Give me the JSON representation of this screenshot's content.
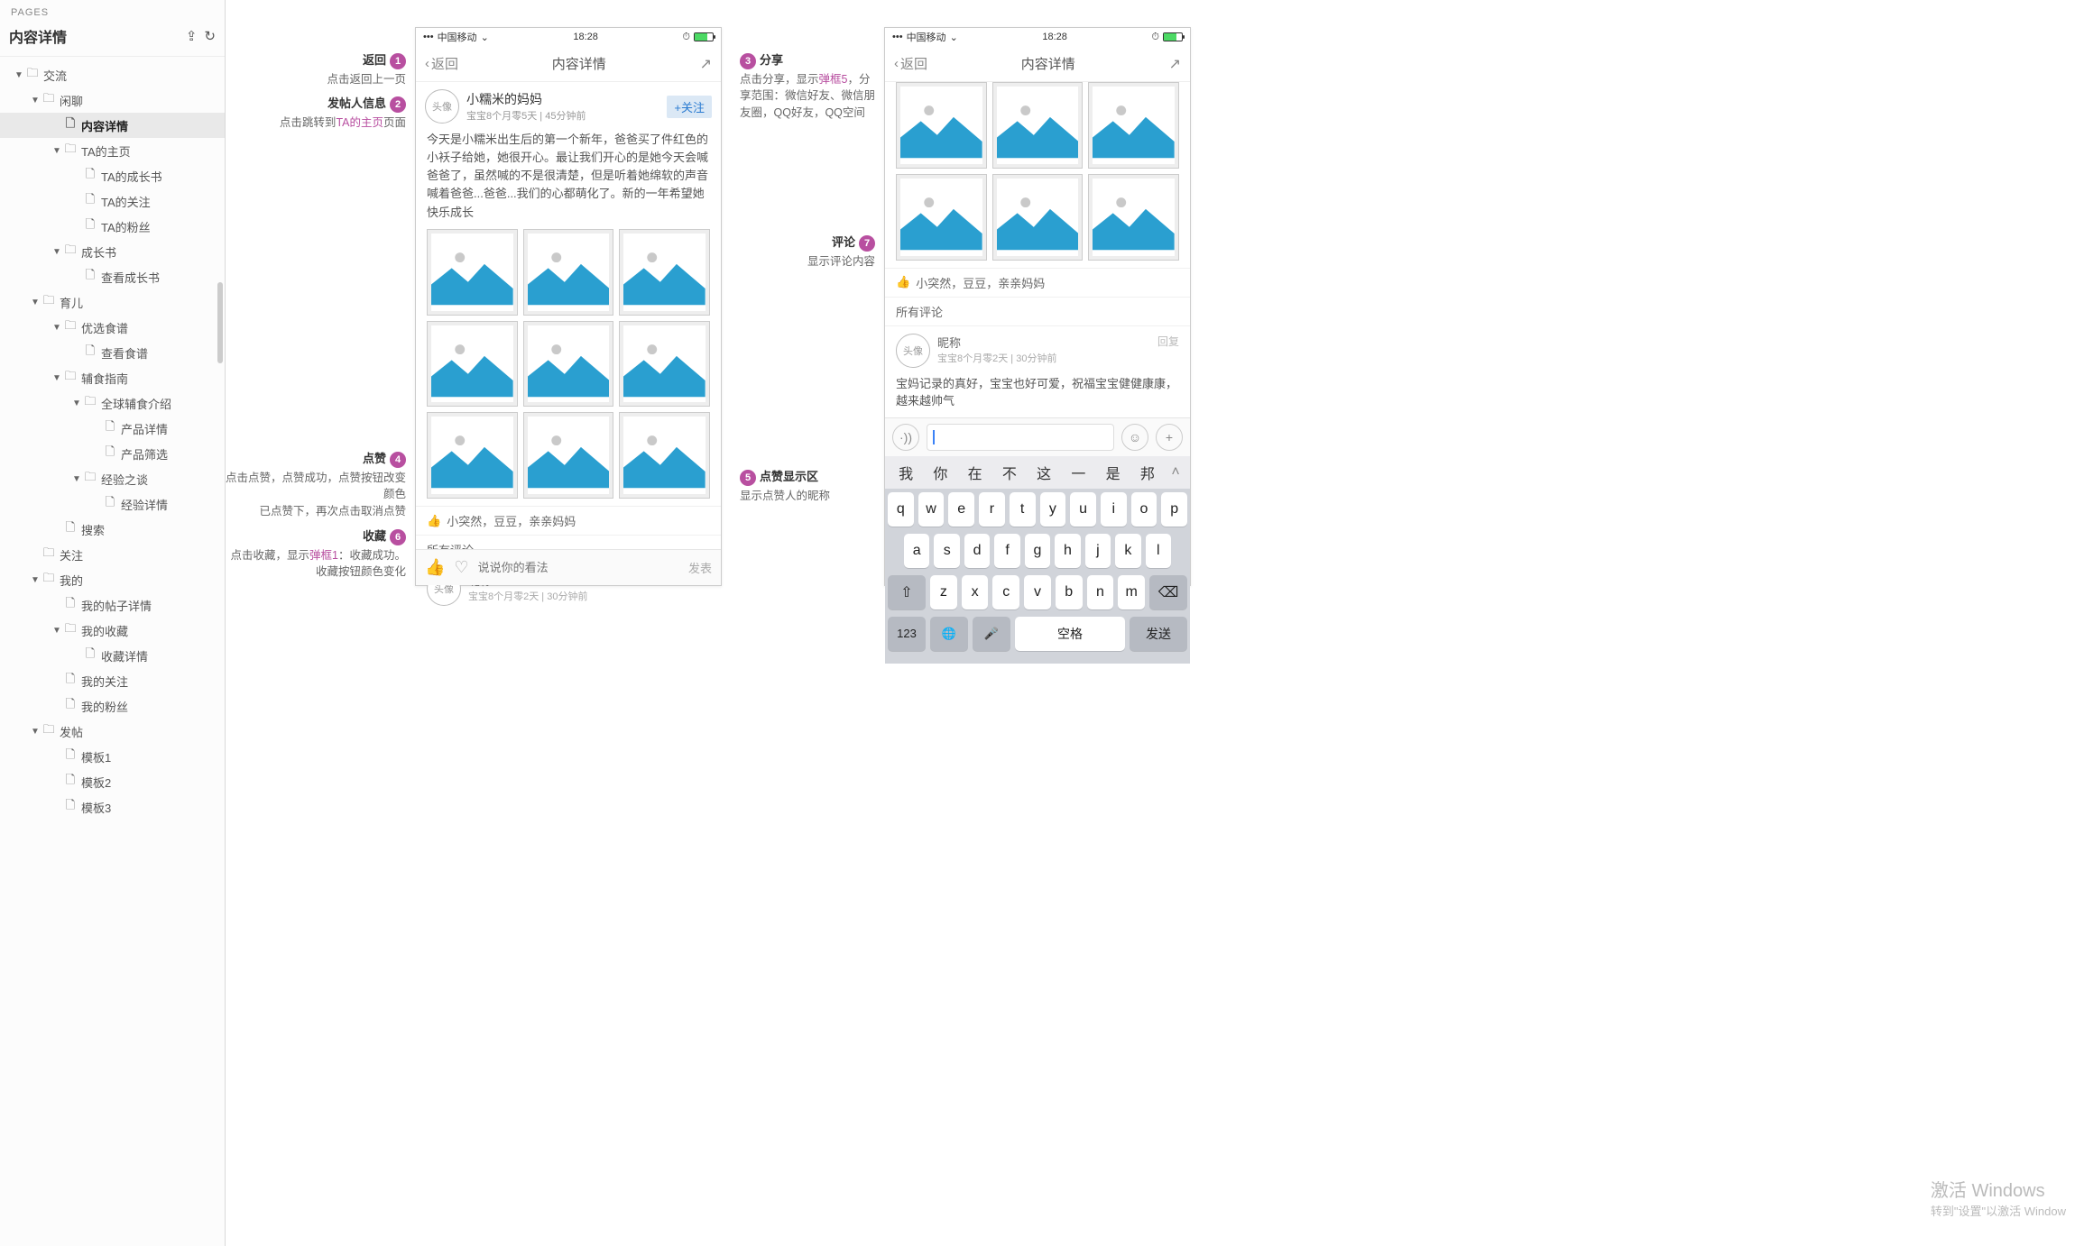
{
  "sidebar": {
    "header": "PAGES",
    "title": "内容详情",
    "tree": [
      {
        "indent": 0,
        "toggle": "▼",
        "icon": "folder",
        "label": "交流"
      },
      {
        "indent": 1,
        "toggle": "▼",
        "icon": "folder",
        "label": "闲聊"
      },
      {
        "indent": 2,
        "toggle": "",
        "icon": "page",
        "label": "内容详情",
        "selected": true
      },
      {
        "indent": 2,
        "toggle": "▼",
        "icon": "folder",
        "label": "TA的主页"
      },
      {
        "indent": 3,
        "toggle": "",
        "icon": "page",
        "label": "TA的成长书"
      },
      {
        "indent": 3,
        "toggle": "",
        "icon": "page",
        "label": "TA的关注"
      },
      {
        "indent": 3,
        "toggle": "",
        "icon": "page",
        "label": "TA的粉丝"
      },
      {
        "indent": 2,
        "toggle": "▼",
        "icon": "folder",
        "label": "成长书"
      },
      {
        "indent": 3,
        "toggle": "",
        "icon": "page",
        "label": "查看成长书"
      },
      {
        "indent": 1,
        "toggle": "▼",
        "icon": "folder",
        "label": "育儿"
      },
      {
        "indent": 2,
        "toggle": "▼",
        "icon": "folder",
        "label": "优选食谱"
      },
      {
        "indent": 3,
        "toggle": "",
        "icon": "page",
        "label": "查看食谱"
      },
      {
        "indent": 2,
        "toggle": "▼",
        "icon": "folder",
        "label": "辅食指南"
      },
      {
        "indent": 3,
        "toggle": "▼",
        "icon": "folder",
        "label": "全球辅食介绍"
      },
      {
        "indent": 4,
        "toggle": "",
        "icon": "page",
        "label": "产品详情"
      },
      {
        "indent": 4,
        "toggle": "",
        "icon": "page",
        "label": "产品筛选"
      },
      {
        "indent": 3,
        "toggle": "▼",
        "icon": "folder",
        "label": "经验之谈"
      },
      {
        "indent": 4,
        "toggle": "",
        "icon": "page",
        "label": "经验详情"
      },
      {
        "indent": 2,
        "toggle": "",
        "icon": "page",
        "label": "搜索"
      },
      {
        "indent": 1,
        "toggle": "",
        "icon": "folder",
        "label": "关注"
      },
      {
        "indent": 1,
        "toggle": "▼",
        "icon": "folder",
        "label": "我的"
      },
      {
        "indent": 2,
        "toggle": "",
        "icon": "page",
        "label": "我的帖子详情"
      },
      {
        "indent": 2,
        "toggle": "▼",
        "icon": "folder",
        "label": "我的收藏"
      },
      {
        "indent": 3,
        "toggle": "",
        "icon": "page",
        "label": "收藏详情"
      },
      {
        "indent": 2,
        "toggle": "",
        "icon": "page",
        "label": "我的关注"
      },
      {
        "indent": 2,
        "toggle": "",
        "icon": "page",
        "label": "我的粉丝"
      },
      {
        "indent": 1,
        "toggle": "▼",
        "icon": "folder",
        "label": "发帖"
      },
      {
        "indent": 2,
        "toggle": "",
        "icon": "page",
        "label": "模板1"
      },
      {
        "indent": 2,
        "toggle": "",
        "icon": "page",
        "label": "模板2"
      },
      {
        "indent": 2,
        "toggle": "",
        "icon": "page",
        "label": "模板3"
      }
    ]
  },
  "phone": {
    "statusbar": {
      "carrier": "中国移动",
      "time": "18:28"
    },
    "navbar": {
      "back": "返回",
      "title": "内容详情"
    },
    "author": {
      "avatar": "头像",
      "name": "小糯米的妈妈",
      "sub": "宝宝8个月零5天 | 45分钟前",
      "follow": "+关注"
    },
    "post_text": "今天是小糯米出生后的第一个新年，爸爸买了件红色的小袄子给她，她很开心。最让我们开心的是她今天会喊爸爸了，虽然喊的不是很清楚，但是听着她绵软的声音喊着爸爸...爸爸...我们的心都萌化了。新的一年希望她快乐成长",
    "likes_label": "小突然，豆豆，亲亲妈妈",
    "all_comments": "所有评论",
    "comment": {
      "avatar": "头像",
      "name": "昵称",
      "sub": "宝宝8个月零2天 | 30分钟前",
      "reply": "回复",
      "body": "宝妈记录的真好，宝宝也好可爱，祝福宝宝健健康康，越来越帅气"
    },
    "inputbar": {
      "placeholder": "说说你的看法",
      "send": "发表"
    }
  },
  "keyboard": {
    "suggestions": [
      "我",
      "你",
      "在",
      "不",
      "这",
      "一",
      "是",
      "邦"
    ],
    "row1": [
      "q",
      "w",
      "e",
      "r",
      "t",
      "y",
      "u",
      "i",
      "o",
      "p"
    ],
    "row2": [
      "a",
      "s",
      "d",
      "f",
      "g",
      "h",
      "j",
      "k",
      "l"
    ],
    "row3": [
      "z",
      "x",
      "c",
      "v",
      "b",
      "n",
      "m"
    ],
    "num": "123",
    "space": "空格",
    "send": "发送"
  },
  "annotations": {
    "a1": {
      "num": "1",
      "title": "返回",
      "body": "点击返回上一页"
    },
    "a2": {
      "num": "2",
      "title": "发帖人信息",
      "body_pre": "点击跳转到",
      "body_link": "TA的主页",
      "body_post": "页面"
    },
    "a3": {
      "num": "3",
      "title": "分享",
      "body_pre": "点击分享，显示",
      "body_link": "弹框5",
      "body_post": "，分享范围：微信好友、微信朋友圈，QQ好友，QQ空间"
    },
    "a4": {
      "num": "4",
      "title": "点赞",
      "body": "点击点赞，点赞成功，点赞按钮改变颜色\n已点赞下，再次点击取消点赞"
    },
    "a5": {
      "num": "5",
      "title": "点赞显示区",
      "body": "显示点赞人的昵称"
    },
    "a6": {
      "num": "6",
      "title": "收藏",
      "body_pre": "点击收藏，显示",
      "body_link": "弹框1",
      "body_post": "：收藏成功。收藏按钮颜色变化"
    },
    "a7": {
      "num": "7",
      "title": "评论",
      "body": "显示评论内容"
    }
  },
  "watermark": {
    "line1": "激活 Windows",
    "line2": "转到\"设置\"以激活 Window"
  }
}
